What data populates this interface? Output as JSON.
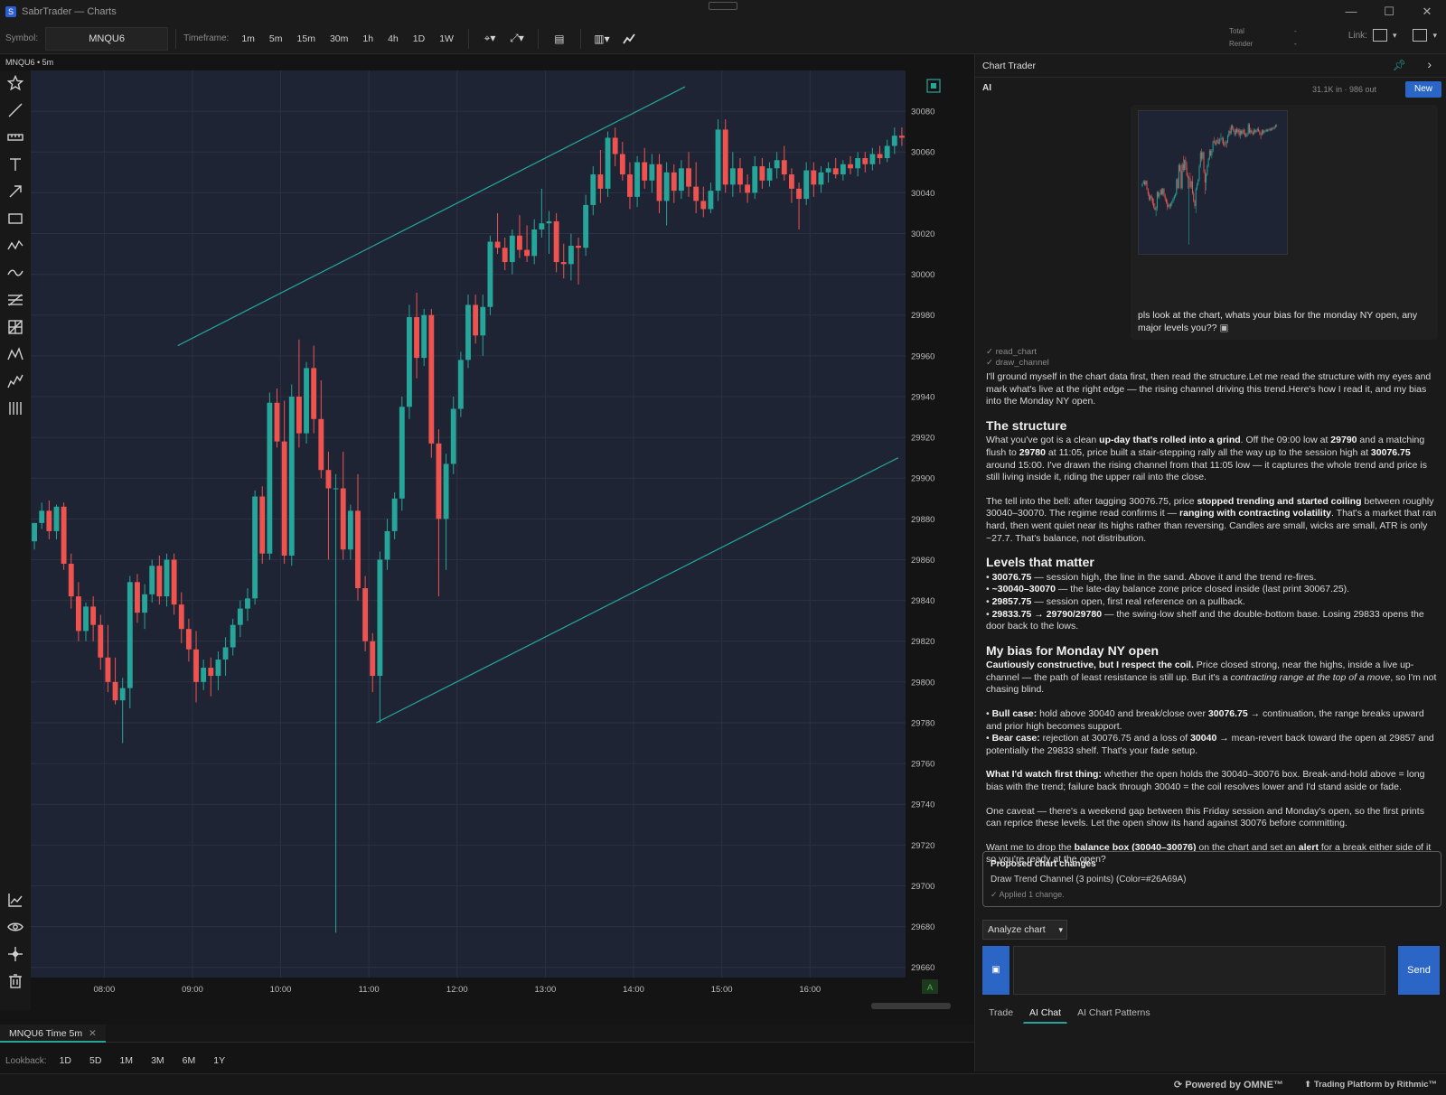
{
  "window": {
    "title": "SabrTrader — Charts",
    "controls": [
      "—",
      "☐",
      "✕"
    ]
  },
  "toolbar": {
    "symbol_label": "Symbol:",
    "symbol": "MNQU6",
    "timeframe_label": "Timeframe:",
    "timeframes": [
      "1m",
      "5m",
      "15m",
      "30m",
      "1h",
      "4h",
      "1D",
      "1W"
    ],
    "total_label": "Total",
    "total_value": "--",
    "render_label": "Render",
    "render_value": "--",
    "link_label": "Link:"
  },
  "chart": {
    "header": "MNQU6 • 5m",
    "corner_badge": "A",
    "colors": {
      "background": "#1e2433",
      "up": "#26a69a",
      "down": "#ef5350",
      "channel": "#26a69a"
    }
  },
  "chart_data": {
    "type": "candlestick",
    "symbol": "MNQU6",
    "interval": "5m",
    "x_ticks": [
      "08:00",
      "09:00",
      "10:00",
      "11:00",
      "12:00",
      "13:00",
      "14:00",
      "15:00",
      "16:00"
    ],
    "y_ticks": [
      30080,
      30060,
      30040,
      30020,
      30000,
      29980,
      29960,
      29940,
      29920,
      29900,
      29880,
      29860,
      29840,
      29820,
      29800,
      29780,
      29760,
      29740,
      29720,
      29700,
      29680,
      29660
    ],
    "ylim": [
      29655,
      30100
    ],
    "x_range": [
      "07:10",
      "17:05"
    ],
    "grid": true,
    "channel": {
      "lower": [
        [
          "11:05",
          29780
        ],
        [
          "17:00",
          29910
        ]
      ],
      "upper": [
        [
          "08:50",
          29965
        ],
        [
          "14:35",
          30092
        ]
      ]
    },
    "candles": [
      [
        "07:10",
        29869,
        29878,
        29865,
        29878
      ],
      [
        "07:15",
        29878,
        29888,
        29875,
        29884
      ],
      [
        "07:20",
        29884,
        29889,
        29870,
        29874
      ],
      [
        "07:25",
        29874,
        29887,
        29870,
        29886
      ],
      [
        "07:30",
        29886,
        29888,
        29855,
        29858
      ],
      [
        "07:35",
        29858,
        29863,
        29836,
        29842
      ],
      [
        "07:40",
        29842,
        29849,
        29820,
        29825
      ],
      [
        "07:45",
        29825,
        29839,
        29820,
        29837
      ],
      [
        "07:50",
        29837,
        29842,
        29820,
        29828
      ],
      [
        "07:55",
        29828,
        29833,
        29806,
        29812
      ],
      [
        "08:00",
        29812,
        29828,
        29795,
        29800
      ],
      [
        "08:05",
        29800,
        29812,
        29789,
        29791
      ],
      [
        "08:10",
        29791,
        29802,
        29770,
        29797
      ],
      [
        "08:15",
        29797,
        29852,
        29787,
        29849
      ],
      [
        "08:20",
        29849,
        29853,
        29829,
        29834
      ],
      [
        "08:25",
        29834,
        29848,
        29826,
        29843
      ],
      [
        "08:30",
        29843,
        29860,
        29839,
        29857
      ],
      [
        "08:35",
        29857,
        29862,
        29838,
        29842
      ],
      [
        "08:40",
        29842,
        29863,
        29837,
        29860
      ],
      [
        "08:45",
        29860,
        29863,
        29833,
        29838
      ],
      [
        "08:50",
        29838,
        29844,
        29819,
        29826
      ],
      [
        "08:55",
        29826,
        29831,
        29810,
        29816
      ],
      [
        "09:00",
        29816,
        29825,
        29790,
        29800
      ],
      [
        "09:05",
        29800,
        29811,
        29796,
        29807
      ],
      [
        "09:10",
        29807,
        29812,
        29793,
        29803
      ],
      [
        "09:15",
        29803,
        29815,
        29796,
        29811
      ],
      [
        "09:20",
        29811,
        29822,
        29803,
        29817
      ],
      [
        "09:25",
        29817,
        29831,
        29813,
        29828
      ],
      [
        "09:30",
        29828,
        29840,
        29822,
        29836
      ],
      [
        "09:35",
        29836,
        29846,
        29830,
        29841
      ],
      [
        "09:40",
        29841,
        29894,
        29838,
        29891
      ],
      [
        "09:45",
        29891,
        29896,
        29858,
        29863
      ],
      [
        "09:50",
        29863,
        29942,
        29860,
        29937
      ],
      [
        "09:55",
        29937,
        29944,
        29915,
        29918
      ],
      [
        "10:00",
        29918,
        29938,
        29858,
        29862
      ],
      [
        "10:05",
        29862,
        29946,
        29857,
        29940
      ],
      [
        "10:10",
        29940,
        29968,
        29915,
        29922
      ],
      [
        "10:15",
        29922,
        29957,
        29917,
        29954
      ],
      [
        "10:20",
        29954,
        29965,
        29922,
        29929
      ],
      [
        "10:25",
        29929,
        29948,
        29900,
        29904
      ],
      [
        "10:30",
        29904,
        29913,
        29860,
        29895
      ],
      [
        "10:35",
        29895,
        29902,
        29677,
        29895
      ],
      [
        "10:40",
        29895,
        29913,
        29860,
        29865
      ],
      [
        "10:45",
        29865,
        29887,
        29860,
        29884
      ],
      [
        "10:50",
        29884,
        29902,
        29840,
        29846
      ],
      [
        "10:55",
        29846,
        29852,
        29815,
        29820
      ],
      [
        "11:00",
        29820,
        29824,
        29795,
        29803
      ],
      [
        "11:05",
        29803,
        29864,
        29780,
        29860
      ],
      [
        "11:10",
        29860,
        29880,
        29855,
        29874
      ],
      [
        "11:15",
        29874,
        29893,
        29870,
        29890
      ],
      [
        "11:20",
        29890,
        29940,
        29884,
        29935
      ],
      [
        "11:25",
        29935,
        29985,
        29929,
        29979
      ],
      [
        "11:30",
        29979,
        29991,
        29949,
        29959
      ],
      [
        "11:35",
        29959,
        29983,
        29955,
        29980
      ],
      [
        "11:40",
        29980,
        29983,
        29910,
        29917
      ],
      [
        "11:45",
        29917,
        29924,
        29842,
        29880
      ],
      [
        "11:50",
        29880,
        29912,
        29855,
        29907
      ],
      [
        "11:55",
        29907,
        29940,
        29902,
        29934
      ],
      [
        "12:00",
        29934,
        29962,
        29930,
        29958
      ],
      [
        "12:05",
        29958,
        29990,
        29954,
        29985
      ],
      [
        "12:10",
        29985,
        29990,
        29966,
        29970
      ],
      [
        "12:15",
        29970,
        29990,
        29960,
        29984
      ],
      [
        "12:20",
        29984,
        30019,
        29980,
        30016
      ],
      [
        "12:25",
        30016,
        30030,
        30010,
        30013
      ],
      [
        "12:30",
        30013,
        30018,
        30002,
        30006
      ],
      [
        "12:35",
        30006,
        30022,
        30000,
        30019
      ],
      [
        "12:40",
        30019,
        30029,
        30008,
        30012
      ],
      [
        "12:45",
        30012,
        30024,
        30006,
        30009
      ],
      [
        "12:50",
        30009,
        30027,
        30005,
        30022
      ],
      [
        "12:55",
        30022,
        30042,
        30018,
        30025
      ],
      [
        "13:00",
        30025,
        30031,
        30010,
        30026
      ],
      [
        "13:05",
        30026,
        30030,
        30001,
        30006
      ],
      [
        "13:10",
        30006,
        30015,
        29998,
        30005
      ],
      [
        "13:15",
        30005,
        30020,
        29997,
        30014
      ],
      [
        "13:20",
        30014,
        30018,
        29995,
        30013
      ],
      [
        "13:25",
        30013,
        30039,
        30009,
        30034
      ],
      [
        "13:30",
        30034,
        30053,
        30029,
        30049
      ],
      [
        "13:35",
        30049,
        30061,
        30035,
        30042
      ],
      [
        "13:40",
        30042,
        30070,
        30038,
        30067
      ],
      [
        "13:45",
        30067,
        30072,
        30053,
        30059
      ],
      [
        "13:50",
        30059,
        30065,
        30046,
        30049
      ],
      [
        "13:55",
        30049,
        30055,
        30032,
        30038
      ],
      [
        "14:00",
        30038,
        30058,
        30033,
        30055
      ],
      [
        "14:05",
        30055,
        30062,
        30042,
        30046
      ],
      [
        "14:10",
        30046,
        30059,
        30040,
        30054
      ],
      [
        "14:15",
        30054,
        30059,
        30030,
        30036
      ],
      [
        "14:20",
        30036,
        30055,
        30024,
        30050
      ],
      [
        "14:25",
        30050,
        30054,
        30035,
        30041
      ],
      [
        "14:30",
        30041,
        30056,
        30037,
        30052
      ],
      [
        "14:35",
        30052,
        30060,
        30038,
        30043
      ],
      [
        "14:40",
        30043,
        30055,
        30030,
        30036
      ],
      [
        "14:45",
        30036,
        30043,
        30028,
        30032
      ],
      [
        "14:50",
        30032,
        30045,
        30030,
        30041
      ],
      [
        "14:55",
        30041,
        30076,
        30036,
        30071
      ],
      [
        "15:00",
        30071,
        30076,
        30040,
        30044
      ],
      [
        "15:05",
        30044,
        30060,
        30038,
        30052
      ],
      [
        "15:10",
        30052,
        30057,
        30040,
        30044
      ],
      [
        "15:15",
        30044,
        30049,
        30035,
        30040
      ],
      [
        "15:20",
        30040,
        30058,
        30037,
        30053
      ],
      [
        "15:25",
        30053,
        30057,
        30042,
        30046
      ],
      [
        "15:30",
        30046,
        30055,
        30043,
        30052
      ],
      [
        "15:35",
        30052,
        30060,
        30047,
        30056
      ],
      [
        "15:40",
        30056,
        30063,
        30046,
        30049
      ],
      [
        "15:45",
        30049,
        30052,
        30035,
        30042
      ],
      [
        "15:50",
        30042,
        30045,
        30022,
        30037
      ],
      [
        "15:55",
        30037,
        30055,
        30034,
        30051
      ],
      [
        "16:00",
        30051,
        30055,
        30038,
        30044
      ],
      [
        "16:05",
        30044,
        30053,
        30040,
        30050
      ],
      [
        "16:10",
        30050,
        30055,
        30045,
        30052
      ],
      [
        "16:15",
        30052,
        30057,
        30047,
        30049
      ],
      [
        "16:20",
        30049,
        30056,
        30046,
        30054
      ],
      [
        "16:25",
        30054,
        30058,
        30049,
        30052
      ],
      [
        "16:30",
        30052,
        30060,
        30048,
        30057
      ],
      [
        "16:35",
        30057,
        30060,
        30050,
        30054
      ],
      [
        "16:40",
        30054,
        30062,
        30051,
        30059
      ],
      [
        "16:45",
        30059,
        30063,
        30054,
        30057
      ],
      [
        "16:50",
        30057,
        30066,
        30055,
        30063
      ],
      [
        "16:55",
        30063,
        30072,
        30059,
        30068
      ],
      [
        "17:00",
        30068,
        30072,
        30063,
        30067
      ]
    ]
  },
  "bottom": {
    "chart_tab": "MNQU6 Time 5m",
    "lookback_label": "Lookback:",
    "lookback_options": [
      "1D",
      "5D",
      "1M",
      "3M",
      "6M",
      "1Y"
    ]
  },
  "status": {
    "powered": "Powered by OMNE™",
    "rithmic": "Trading Platform by Rithmic™"
  },
  "panel": {
    "title": "Chart Trader",
    "ai_label": "AI",
    "tokens": "31.1K in · 986 out",
    "new_label": "New",
    "user_message": "pls look at the chart, whats your bias for the monday NY open, any major levels you??",
    "tool_calls": [
      "✓ read_chart",
      "✓ draw_channel"
    ],
    "intro": "I'll ground myself in the chart data first, then read the structure.Let me read the structure with my eyes and mark what's live at the right edge — the rising channel driving this trend.Here's how I read it, and my bias into the Monday NY open.",
    "h_structure": "The structure",
    "s1": {
      "t1": "What you've got is a clean ",
      "b1": "up-day that's rolled into a grind",
      "t2": ". Off the 09:00 low at ",
      "b2": "29790",
      "t3": " and a matching flush to ",
      "b3": "29780",
      "t4": " at 11:05, price built a stair-stepping rally all the way up to the session high at ",
      "b4": "30076.75",
      "t5": " around 15:00. I've drawn the rising channel from that 11:05 low — it captures the whole trend and price is still living inside it, riding the upper rail into the close."
    },
    "s2": {
      "t1": "The tell into the bell: after tagging 30076.75, price ",
      "b1": "stopped trending and started coiling",
      "t2": " between roughly 30040–30070. The regime read confirms it — ",
      "b2": "ranging with contracting volatility",
      "t3": ". That's a market that ran hard, then went quiet near its highs rather than reversing. Candles are small, wicks are small, ATR is only ~27.7. That's balance, not distribution."
    },
    "h_levels": "Levels that matter",
    "levels": [
      {
        "b": "30076.75",
        "t": " — session high, the line in the sand. Above it and the trend re-fires."
      },
      {
        "b": "~30040–30070",
        "t": " — the late-day balance zone price closed inside (last print 30067.25)."
      },
      {
        "b": "29857.75",
        "t": " — session open, first real reference on a pullback."
      },
      {
        "b": "29833.75 → 29790/29780",
        "t": " — the swing-low shelf and the double-bottom base. Losing 29833 opens the door back to the lows."
      }
    ],
    "h_bias": "My bias for Monday NY open",
    "bias": {
      "b1": "Cautiously constructive, but I respect the coil.",
      "t1": " Price closed strong, near the highs, inside a live up-channel — the path of least resistance is still up. But it's a ",
      "i1": "contracting range at the top of a move",
      "t2": ", so I'm not chasing blind."
    },
    "bull": {
      "b1": "Bull case:",
      "t1": " hold above 30040 and break/close over ",
      "b2": "30076.75",
      "t2": " → continuation, the range breaks upward and prior high becomes support."
    },
    "bear": {
      "b1": "Bear case:",
      "t1": " rejection at 30076.75 and a loss of ",
      "b2": "30040",
      "t2": " → mean-revert back toward the open at 29857 and potentially the 29833 shelf. That's your fade setup."
    },
    "watch": {
      "b1": "What I'd watch first thing:",
      "t1": " whether the open holds the 30040–30076 box. Break-and-hold above = long bias with the trend; failure back through 30040 = the coil resolves lower and I'd stand aside or fade."
    },
    "caveat": "One caveat — there's a weekend gap between this Friday session and Monday's open, so the first prints can reprice these levels. Let the open show its hand against 30076 before committing.",
    "offer": {
      "t1": "Want me to drop the ",
      "b1": "balance box (30040–30076)",
      "t2": " on the chart and set an ",
      "b2": "alert",
      "t3": " for a break either side of it so you're ready at the open?"
    },
    "proposed_title": "Proposed chart changes",
    "proposed_item": "Draw Trend Channel (3 points) (Color=#26A69A)",
    "proposed_applied": "✓ Applied 1 change.",
    "analyze_label": "Analyze chart",
    "send_label": "Send",
    "tabs": [
      "Trade",
      "AI Chat",
      "AI Chart Patterns"
    ]
  }
}
